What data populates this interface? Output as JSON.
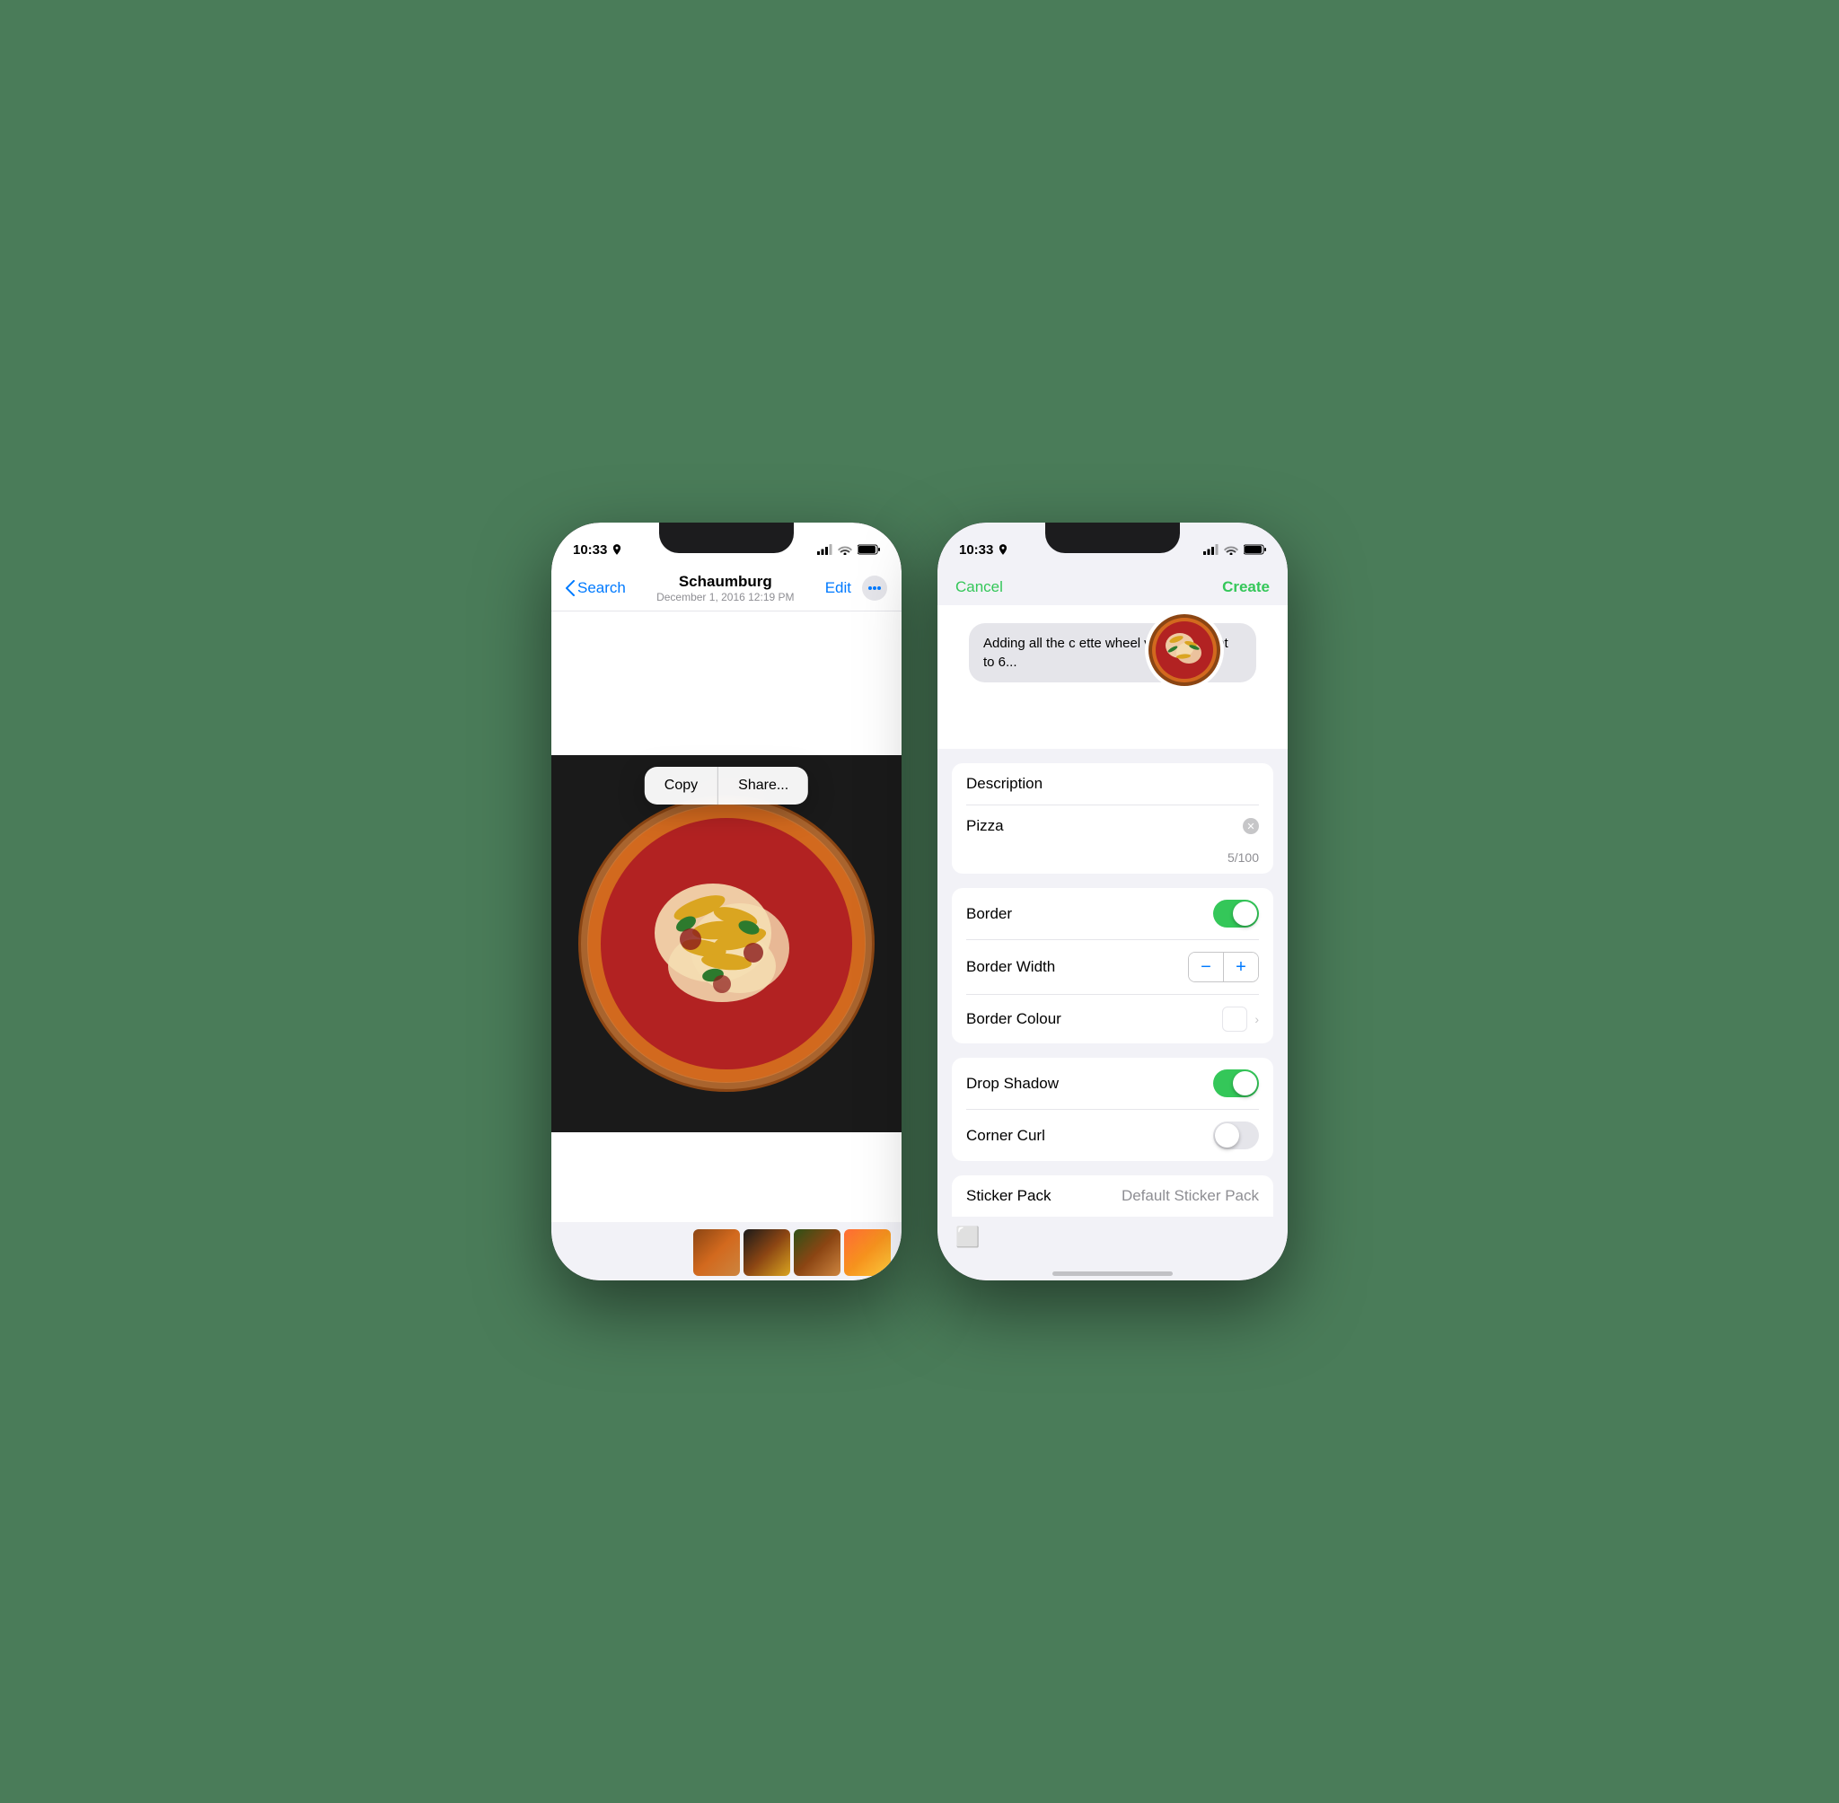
{
  "phone1": {
    "status": {
      "time": "10:33",
      "location_icon": true
    },
    "nav": {
      "back_label": "Search",
      "title": "Schaumburg",
      "subtitle": "December 1, 2016  12:19 PM",
      "edit_label": "Edit"
    },
    "context_menu": {
      "copy_label": "Copy",
      "share_label": "Share..."
    },
    "toolbar": {
      "share_icon": "share",
      "like_icon": "heart",
      "info_icon": "info",
      "delete_icon": "trash"
    }
  },
  "phone2": {
    "status": {
      "time": "10:33",
      "location_icon": true
    },
    "sheet": {
      "cancel_label": "Cancel",
      "create_label": "Create"
    },
    "preview": {
      "message_text": "Adding all the c        ette wheel will equivalent to 6..."
    },
    "form": {
      "description_label": "Description",
      "description_value": "Pizza",
      "char_count": "5/100",
      "border_label": "Border",
      "border_enabled": true,
      "border_width_label": "Border Width",
      "border_colour_label": "Border Colour",
      "drop_shadow_label": "Drop Shadow",
      "drop_shadow_enabled": true,
      "corner_curl_label": "Corner Curl",
      "corner_curl_enabled": false,
      "sticker_pack_label": "Sticker Pack",
      "sticker_pack_value": "Default Sticker Pack"
    }
  }
}
